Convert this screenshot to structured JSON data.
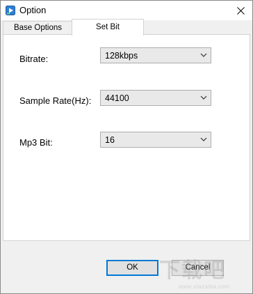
{
  "window": {
    "title": "Option",
    "colors": {
      "accent": "#0078d7",
      "panel": "#ffffff",
      "chrome": "#f0f0f0"
    }
  },
  "tabs": [
    {
      "label": "Base Options",
      "active": false
    },
    {
      "label": "Set Bit",
      "active": true
    }
  ],
  "form": {
    "bitrate": {
      "label": "Bitrate:",
      "value": "128kbps"
    },
    "sample_rate": {
      "label": "Sample Rate(Hz):",
      "value": "44100"
    },
    "mp3_bit": {
      "label": "Mp3 Bit:",
      "value": "16"
    }
  },
  "buttons": {
    "ok": "OK",
    "cancel": "Cancel"
  },
  "watermark": {
    "glyphs": "下载吧",
    "url": "www.xiazaiba.com"
  }
}
